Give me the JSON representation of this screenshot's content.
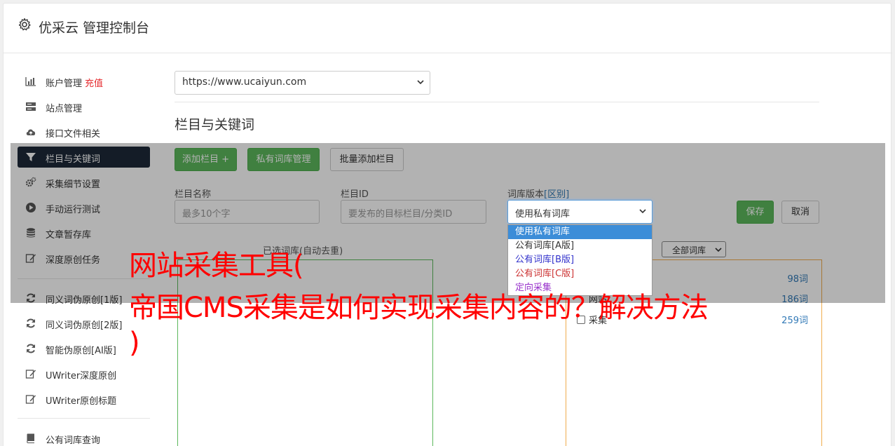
{
  "header": {
    "title": "优采云 管理控制台"
  },
  "sidebar": {
    "items": [
      {
        "label": "账户管理",
        "extra": "充值",
        "icon": "bar-chart-icon"
      },
      {
        "label": "站点管理",
        "icon": "server-icon"
      },
      {
        "label": "接口文件相关",
        "icon": "cloud-upload-icon"
      },
      {
        "label": "栏目与关键词",
        "icon": "filter-icon",
        "active": true
      },
      {
        "label": "采集细节设置",
        "icon": "cogs-icon"
      },
      {
        "label": "手动运行测试",
        "icon": "play-circle-icon"
      },
      {
        "label": "文章暂存库",
        "icon": "database-icon"
      },
      {
        "label": "深度原创任务",
        "icon": "edit-icon"
      },
      {
        "label": "同义词伪原创[1版]",
        "icon": "refresh-icon"
      },
      {
        "label": "同义词伪原创[2版]",
        "icon": "refresh-icon"
      },
      {
        "label": "智能伪原创[AI版]",
        "icon": "refresh-icon"
      },
      {
        "label": "UWriter深度原创",
        "icon": "edit-icon"
      },
      {
        "label": "UWriter原创标题",
        "icon": "edit-icon"
      },
      {
        "label": "公有词库查询",
        "icon": "book-icon"
      }
    ]
  },
  "main": {
    "site_select": "https://www.ucaiyun.com",
    "section_title": "栏目与关键词",
    "buttons": {
      "add_column": "添加栏目 +",
      "private_dict": "私有词库管理",
      "batch_add": "批量添加栏目",
      "save": "保存",
      "cancel": "取消"
    },
    "form": {
      "column_name_label": "栏目名称",
      "column_name_placeholder": "最多10个字",
      "column_id_label": "栏目ID",
      "column_id_placeholder": "要发布的目标栏目/分类ID",
      "dict_version_label": "词库版本",
      "dict_version_link": "[区别]",
      "dict_version_value": "使用私有词库"
    },
    "dropdown_options": [
      {
        "label": "使用私有词库",
        "color": "#ffffff",
        "selected": true
      },
      {
        "label": "公有词库[A版]",
        "color": "#333333"
      },
      {
        "label": "公有词库[B版]",
        "color": "#3333cc"
      },
      {
        "label": "公有词库[C版]",
        "color": "#cc3333"
      },
      {
        "label": "定向采集",
        "color": "#9933cc"
      }
    ],
    "selected_panel_title": "已选词库(自动去重)",
    "all_dict_select": "全部词库",
    "dict_list": [
      {
        "name": "",
        "count": "98词"
      },
      {
        "name": "网站",
        "count": "186词"
      },
      {
        "name": "采集",
        "count": "259词"
      }
    ]
  },
  "overlay_text": {
    "line1": "网站采集工具(",
    "line2": "帝国CMS采集是如何实现采集内容的？解决方法",
    "line3": ")"
  }
}
